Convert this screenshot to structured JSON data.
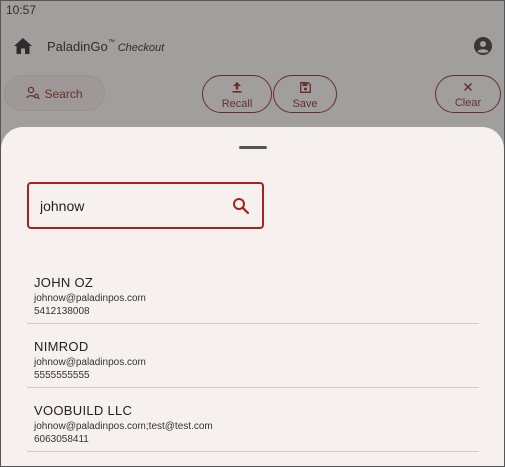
{
  "status_bar": {
    "time": "10:57"
  },
  "app_bar": {
    "title": "PaladinGo",
    "trademark": "™",
    "subtitle": "Checkout"
  },
  "toolbar": {
    "search_label": "Search",
    "recall_label": "Recall",
    "save_label": "Save",
    "clear_label": "Clear"
  },
  "sheet": {
    "search": {
      "value": "johnow"
    },
    "results": [
      {
        "name": "JOHN OZ",
        "email": "johnow@paladinpos.com",
        "phone": "5412138008"
      },
      {
        "name": "NIMROD",
        "email": "johnow@paladinpos.com",
        "phone": "5555555555"
      },
      {
        "name": "VOOBUILD LLC",
        "email": "johnow@paladinpos.com;test@test.com",
        "phone": "6063058411"
      }
    ]
  },
  "colors": {
    "accent": "#a32222",
    "sheet_bg": "#f6f1ef",
    "scrim": "#8e8c8c"
  },
  "icons": {
    "home": "home-icon",
    "account": "account-circle-icon",
    "search": "search-icon",
    "recall": "upload-icon",
    "save": "floppy-disk-icon",
    "clear": "close-icon"
  }
}
